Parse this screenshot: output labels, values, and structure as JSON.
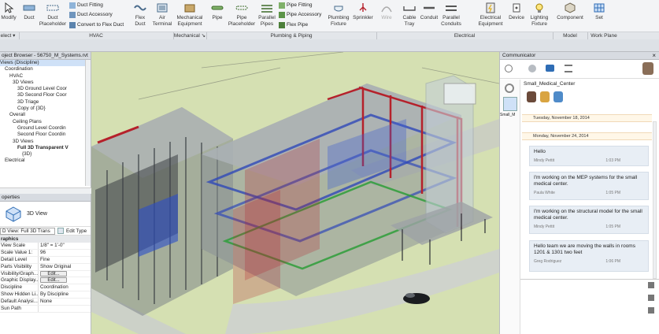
{
  "ribbon": {
    "modify": "Modify",
    "duct": "Duct",
    "duct_placeholder": "Duct\nPlaceholder",
    "duct_fitting": "Duct  Fitting",
    "duct_accessory": "Duct  Accessory",
    "convert_to_flex": "Convert to  Flex Duct",
    "flex_duct": "Flex\nDuct",
    "air_terminal": "Air\nTerminal",
    "mechanical_equipment": "Mechanical\nEquipment",
    "pipe": "Pipe",
    "pipe_placeholder": "Pipe\nPlaceholder",
    "parallel_pipes": "Parallel\nPipes",
    "pipe_fitting": "Pipe  Fitting",
    "pipe_accessory": "Pipe  Accessory",
    "flex_pipe": "Flex  Pipe",
    "plumbing_fixture": "Plumbing\nFixture",
    "sprinkler": "Sprinkler",
    "wire": "Wire",
    "cable_tray": "Cable\nTray",
    "conduit": "Conduit",
    "parallel_conduits": "Parallel\nConduits",
    "electrical_equipment": "Electrical\nEquipment",
    "device": "Device",
    "lighting_fixture": "Lighting\nFixture",
    "component": "Component",
    "set": "Set",
    "panels": {
      "select": "elect ▾",
      "hvac": "HVAC",
      "mechanical": "Mechanical ↘",
      "plumbing": "Plumbing & Piping",
      "electrical": "Electrical",
      "model": "Model",
      "work_plane": "Work Plane"
    }
  },
  "project_browser": {
    "title": "oject Browser - 56750_M_Systems.rvt",
    "rows": [
      "Views (Discipline)",
      "Coordination",
      "HVAC",
      "3D Views",
      "3D Ground Level Coor",
      "3D Second Floor Coor",
      "3D Triage",
      "Copy of {3D}",
      "Overall",
      "Ceiling Plans",
      "Ground Level Coordin",
      "Second Floor Coordin",
      "3D Views",
      "Full 3D Transparent V",
      "{3D}",
      "Electrical"
    ]
  },
  "properties": {
    "title": "operties",
    "type_name": "3D View",
    "selector": "D View: Full 3D Trans",
    "edit_type": "Edit Type",
    "section": "raphics",
    "rows": [
      {
        "k": "View Scale",
        "v": "1/8\" = 1'-0\""
      },
      {
        "k": "Scale Value    1:",
        "v": "96"
      },
      {
        "k": "Detail Level",
        "v": "Fine"
      },
      {
        "k": "Parts Visibility",
        "v": "Show Original"
      },
      {
        "k": "Visibility/Graph...",
        "v": "Edit..."
      },
      {
        "k": "Graphic Display...",
        "v": "Edit..."
      },
      {
        "k": "Discipline",
        "v": "Coordination"
      },
      {
        "k": "Show Hidden Li...",
        "v": "By Discipline"
      },
      {
        "k": "Default Analysi...",
        "v": "None"
      },
      {
        "k": "Sun Path",
        "v": ""
      }
    ]
  },
  "communicator": {
    "title": "Communicator",
    "project": "Small_Medical_Center",
    "user_short": "Small_M",
    "dates": [
      "Tuesday, November 18, 2014",
      "Monday, November 24, 2014"
    ],
    "messages": [
      {
        "text": "Hello",
        "author": "Mindy Pettit",
        "time": "1:03 PM"
      },
      {
        "text": "I'm working on the MEP systems for the small medical center.",
        "author": "Paula White",
        "time": "1:05 PM"
      },
      {
        "text": "I'm working on the structural model for the small medical center.",
        "author": "Mindy Pettit",
        "time": "1:05 PM"
      },
      {
        "text": "Hello team we are moving the walls in rooms 1201 & 1301 two feet",
        "author": "Greg Rodriguez",
        "time": "1:06 PM"
      }
    ]
  },
  "colors": {
    "accent": "#2f6db5",
    "building_red": "#b5212b",
    "grass": "#d4dfb0"
  }
}
